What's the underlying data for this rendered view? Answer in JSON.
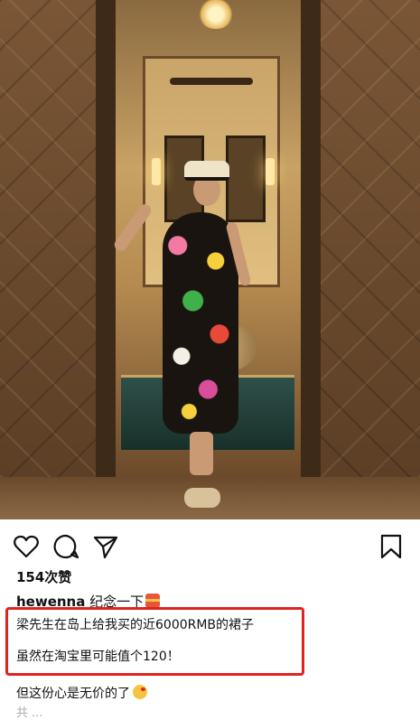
{
  "post": {
    "likes": "154次赞",
    "username": "hewenna",
    "caption_first": " 纪念一下",
    "lines": [
      "梁先生在岛上给我买的近6000RMB的裙子",
      "虽然在淘宝里可能值个120！",
      "但这份心是无价的了"
    ],
    "cutoff_text": "共 ..."
  },
  "icons": [
    "heart-icon",
    "comment-icon",
    "share-icon",
    "bookmark-icon"
  ],
  "colors": {
    "highlight_border": "#e0231f",
    "text": "#111111"
  }
}
